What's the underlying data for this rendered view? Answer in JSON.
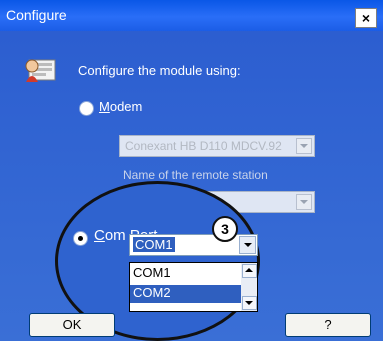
{
  "window": {
    "title": "Configure",
    "close_glyph": "×"
  },
  "header": {
    "text": "Configure the module using:"
  },
  "modem": {
    "label_underlined": "M",
    "label_rest": "odem",
    "device": "Conexant HB D110 MDCV.92"
  },
  "remote": {
    "label": "Name of the remote station"
  },
  "comport": {
    "label_underlined": "C",
    "label_rest": "om Port",
    "selected": "COM1",
    "options": [
      "COM1",
      "COM2"
    ]
  },
  "callout": {
    "number": "3"
  },
  "buttons": {
    "ok": "OK",
    "help": "?"
  },
  "colors": {
    "window_blue": "#2f63cf",
    "selection": "#2f5fbf"
  }
}
